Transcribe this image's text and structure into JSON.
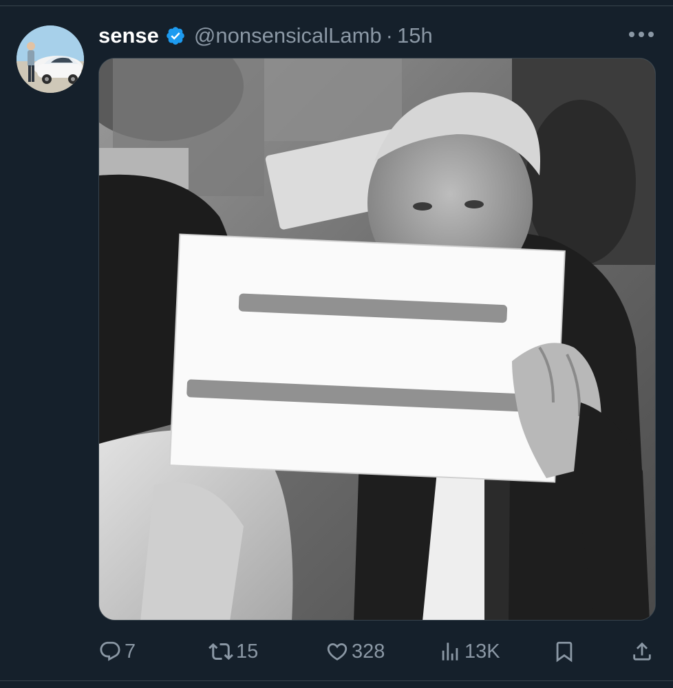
{
  "post": {
    "author": {
      "display_name": "sense",
      "handle": "@nonsensicalLamb",
      "verified": true,
      "avatar_icon": "avatar-person-with-white-car"
    },
    "separator": "·",
    "time": "15h",
    "more_icon": "more-horizontal-icon",
    "media": {
      "description_icon": "photo-man-holding-sign"
    },
    "actions": {
      "replies": "7",
      "reposts": "15",
      "likes": "328",
      "views": "13K"
    }
  },
  "colors": {
    "background": "#15202b",
    "text_primary": "#ffffff",
    "text_secondary": "#8b98a5",
    "verified_badge": "#1d9bf0",
    "divider": "#38444d"
  }
}
